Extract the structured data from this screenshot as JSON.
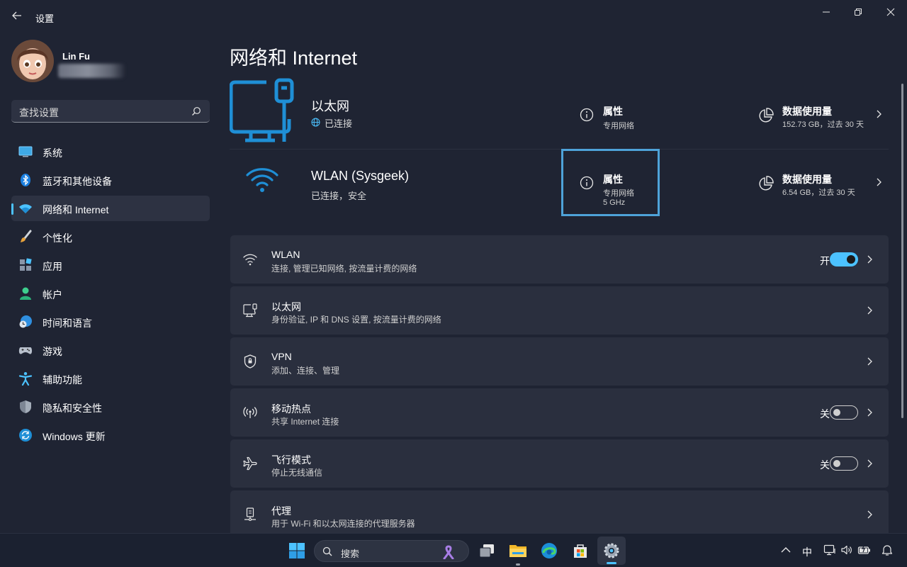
{
  "window": {
    "title": "设置",
    "controls": [
      "minimize",
      "restore",
      "close"
    ]
  },
  "user": {
    "name": "Lin Fu"
  },
  "search": {
    "placeholder": "查找设置"
  },
  "sidebar": {
    "items": [
      {
        "label": "系统",
        "icon": "system-icon",
        "active": false
      },
      {
        "label": "蓝牙和其他设备",
        "icon": "bluetooth-icon",
        "active": false
      },
      {
        "label": "网络和 Internet",
        "icon": "wifi-icon",
        "active": true
      },
      {
        "label": "个性化",
        "icon": "brush-icon",
        "active": false
      },
      {
        "label": "应用",
        "icon": "apps-icon",
        "active": false
      },
      {
        "label": "帐户",
        "icon": "account-icon",
        "active": false
      },
      {
        "label": "时间和语言",
        "icon": "globe-clock-icon",
        "active": false
      },
      {
        "label": "游戏",
        "icon": "gamepad-icon",
        "active": false
      },
      {
        "label": "辅助功能",
        "icon": "accessibility-icon",
        "active": false
      },
      {
        "label": "隐私和安全性",
        "icon": "shield-icon",
        "active": false
      },
      {
        "label": "Windows 更新",
        "icon": "update-icon",
        "active": false
      }
    ]
  },
  "page": {
    "title": "网络和 Internet"
  },
  "connections": [
    {
      "name": "以太网",
      "status": "已连接",
      "properties_title": "属性",
      "properties_sub1": "专用网络",
      "properties_sub2": "",
      "usage_title": "数据使用量",
      "usage_sub": "152.73 GB，过去 30 天"
    },
    {
      "name": "WLAN (Sysgeek)",
      "status": "已连接，安全",
      "properties_title": "属性",
      "properties_sub1": "专用网络",
      "properties_sub2": "5 GHz",
      "usage_title": "数据使用量",
      "usage_sub": "6.54 GB，过去 30 天"
    }
  ],
  "cards": [
    {
      "title": "WLAN",
      "subtitle": "连接, 管理已知网络, 按流量计费的网络",
      "icon": "wifi-icon",
      "toggle": "on",
      "toggle_label": "开"
    },
    {
      "title": "以太网",
      "subtitle": "身份验证, IP 和 DNS 设置, 按流量计费的网络",
      "icon": "ethernet-icon",
      "toggle": null,
      "toggle_label": ""
    },
    {
      "title": "VPN",
      "subtitle": "添加、连接、管理",
      "icon": "vpn-shield-icon",
      "toggle": null,
      "toggle_label": ""
    },
    {
      "title": "移动热点",
      "subtitle": "共享 Internet 连接",
      "icon": "hotspot-icon",
      "toggle": "off",
      "toggle_label": "关"
    },
    {
      "title": "飞行模式",
      "subtitle": "停止无线通信",
      "icon": "airplane-icon",
      "toggle": "off",
      "toggle_label": "关"
    },
    {
      "title": "代理",
      "subtitle": "用于 Wi-Fi 和以太网连接的代理服务器",
      "icon": "proxy-icon",
      "toggle": null,
      "toggle_label": ""
    }
  ],
  "taskbar": {
    "search_label": "搜索",
    "apps": [
      "start-icon",
      "task-view-icon",
      "file-explorer-icon",
      "edge-icon",
      "store-icon",
      "settings-icon"
    ],
    "ime_label": "中"
  },
  "colors": {
    "accent": "#4cc2ff",
    "highlight_box": "#4ea3d9",
    "window_bg": "#1f2433",
    "card_bg": "#2a2f3e"
  }
}
